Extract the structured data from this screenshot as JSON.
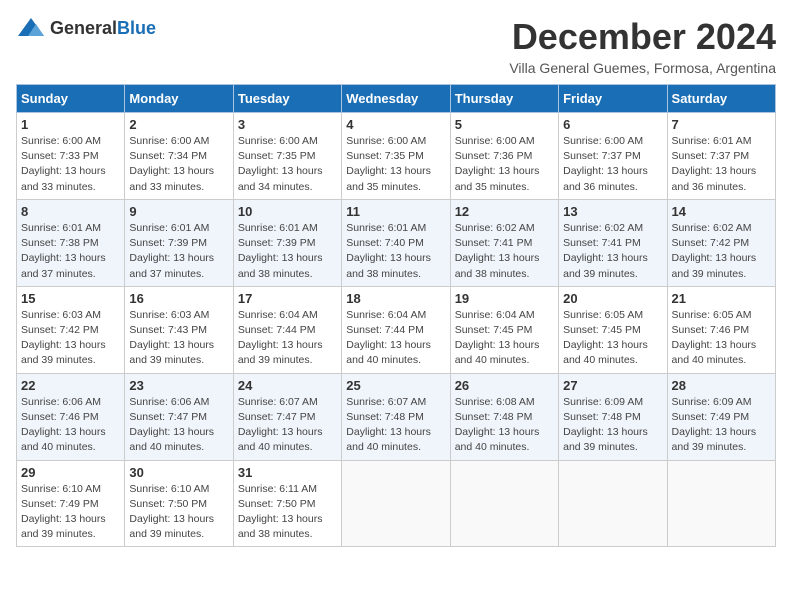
{
  "header": {
    "logo_general": "General",
    "logo_blue": "Blue",
    "month_title": "December 2024",
    "subtitle": "Villa General Guemes, Formosa, Argentina"
  },
  "days_of_week": [
    "Sunday",
    "Monday",
    "Tuesday",
    "Wednesday",
    "Thursday",
    "Friday",
    "Saturday"
  ],
  "weeks": [
    [
      {
        "day": "1",
        "detail": "Sunrise: 6:00 AM\nSunset: 7:33 PM\nDaylight: 13 hours\nand 33 minutes."
      },
      {
        "day": "2",
        "detail": "Sunrise: 6:00 AM\nSunset: 7:34 PM\nDaylight: 13 hours\nand 33 minutes."
      },
      {
        "day": "3",
        "detail": "Sunrise: 6:00 AM\nSunset: 7:35 PM\nDaylight: 13 hours\nand 34 minutes."
      },
      {
        "day": "4",
        "detail": "Sunrise: 6:00 AM\nSunset: 7:35 PM\nDaylight: 13 hours\nand 35 minutes."
      },
      {
        "day": "5",
        "detail": "Sunrise: 6:00 AM\nSunset: 7:36 PM\nDaylight: 13 hours\nand 35 minutes."
      },
      {
        "day": "6",
        "detail": "Sunrise: 6:00 AM\nSunset: 7:37 PM\nDaylight: 13 hours\nand 36 minutes."
      },
      {
        "day": "7",
        "detail": "Sunrise: 6:01 AM\nSunset: 7:37 PM\nDaylight: 13 hours\nand 36 minutes."
      }
    ],
    [
      {
        "day": "8",
        "detail": "Sunrise: 6:01 AM\nSunset: 7:38 PM\nDaylight: 13 hours\nand 37 minutes."
      },
      {
        "day": "9",
        "detail": "Sunrise: 6:01 AM\nSunset: 7:39 PM\nDaylight: 13 hours\nand 37 minutes."
      },
      {
        "day": "10",
        "detail": "Sunrise: 6:01 AM\nSunset: 7:39 PM\nDaylight: 13 hours\nand 38 minutes."
      },
      {
        "day": "11",
        "detail": "Sunrise: 6:01 AM\nSunset: 7:40 PM\nDaylight: 13 hours\nand 38 minutes."
      },
      {
        "day": "12",
        "detail": "Sunrise: 6:02 AM\nSunset: 7:41 PM\nDaylight: 13 hours\nand 38 minutes."
      },
      {
        "day": "13",
        "detail": "Sunrise: 6:02 AM\nSunset: 7:41 PM\nDaylight: 13 hours\nand 39 minutes."
      },
      {
        "day": "14",
        "detail": "Sunrise: 6:02 AM\nSunset: 7:42 PM\nDaylight: 13 hours\nand 39 minutes."
      }
    ],
    [
      {
        "day": "15",
        "detail": "Sunrise: 6:03 AM\nSunset: 7:42 PM\nDaylight: 13 hours\nand 39 minutes."
      },
      {
        "day": "16",
        "detail": "Sunrise: 6:03 AM\nSunset: 7:43 PM\nDaylight: 13 hours\nand 39 minutes."
      },
      {
        "day": "17",
        "detail": "Sunrise: 6:04 AM\nSunset: 7:44 PM\nDaylight: 13 hours\nand 39 minutes."
      },
      {
        "day": "18",
        "detail": "Sunrise: 6:04 AM\nSunset: 7:44 PM\nDaylight: 13 hours\nand 40 minutes."
      },
      {
        "day": "19",
        "detail": "Sunrise: 6:04 AM\nSunset: 7:45 PM\nDaylight: 13 hours\nand 40 minutes."
      },
      {
        "day": "20",
        "detail": "Sunrise: 6:05 AM\nSunset: 7:45 PM\nDaylight: 13 hours\nand 40 minutes."
      },
      {
        "day": "21",
        "detail": "Sunrise: 6:05 AM\nSunset: 7:46 PM\nDaylight: 13 hours\nand 40 minutes."
      }
    ],
    [
      {
        "day": "22",
        "detail": "Sunrise: 6:06 AM\nSunset: 7:46 PM\nDaylight: 13 hours\nand 40 minutes."
      },
      {
        "day": "23",
        "detail": "Sunrise: 6:06 AM\nSunset: 7:47 PM\nDaylight: 13 hours\nand 40 minutes."
      },
      {
        "day": "24",
        "detail": "Sunrise: 6:07 AM\nSunset: 7:47 PM\nDaylight: 13 hours\nand 40 minutes."
      },
      {
        "day": "25",
        "detail": "Sunrise: 6:07 AM\nSunset: 7:48 PM\nDaylight: 13 hours\nand 40 minutes."
      },
      {
        "day": "26",
        "detail": "Sunrise: 6:08 AM\nSunset: 7:48 PM\nDaylight: 13 hours\nand 40 minutes."
      },
      {
        "day": "27",
        "detail": "Sunrise: 6:09 AM\nSunset: 7:48 PM\nDaylight: 13 hours\nand 39 minutes."
      },
      {
        "day": "28",
        "detail": "Sunrise: 6:09 AM\nSunset: 7:49 PM\nDaylight: 13 hours\nand 39 minutes."
      }
    ],
    [
      {
        "day": "29",
        "detail": "Sunrise: 6:10 AM\nSunset: 7:49 PM\nDaylight: 13 hours\nand 39 minutes."
      },
      {
        "day": "30",
        "detail": "Sunrise: 6:10 AM\nSunset: 7:50 PM\nDaylight: 13 hours\nand 39 minutes."
      },
      {
        "day": "31",
        "detail": "Sunrise: 6:11 AM\nSunset: 7:50 PM\nDaylight: 13 hours\nand 38 minutes."
      },
      null,
      null,
      null,
      null
    ]
  ]
}
